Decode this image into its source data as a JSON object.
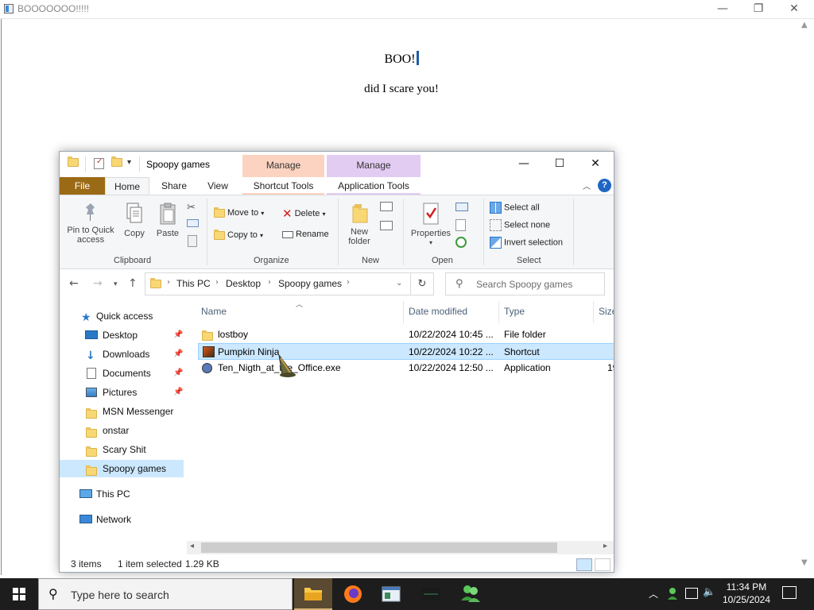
{
  "background_window": {
    "title": "BOOOOOOO!!!!!",
    "heading": "BOO!",
    "message": "did I scare you!"
  },
  "explorer": {
    "title": "Spoopy games",
    "context_tabs": {
      "shortcut": "Manage",
      "application": "Manage"
    },
    "tabs": {
      "file": "File",
      "home": "Home",
      "share": "Share",
      "view": "View",
      "shortcut_tools": "Shortcut Tools",
      "application_tools": "Application Tools"
    },
    "ribbon": {
      "clipboard": {
        "pin": "Pin to Quick access",
        "copy": "Copy",
        "paste": "Paste",
        "label": "Clipboard"
      },
      "organize": {
        "move_to": "Move to",
        "copy_to": "Copy to",
        "delete": "Delete",
        "rename": "Rename",
        "label": "Organize"
      },
      "new": {
        "new_folder": "New folder",
        "label": "New"
      },
      "open": {
        "properties": "Properties",
        "label": "Open"
      },
      "select": {
        "select_all": "Select all",
        "select_none": "Select none",
        "invert": "Invert selection",
        "label": "Select"
      }
    },
    "address": {
      "crumbs": [
        "This PC",
        "Desktop",
        "Spoopy games"
      ]
    },
    "search_placeholder": "Search Spoopy games",
    "nav": {
      "quick_access": "Quick access",
      "items": [
        "Desktop",
        "Downloads",
        "Documents",
        "Pictures",
        "MSN Messenger",
        "onstar",
        "Scary Shit",
        "Spoopy games"
      ],
      "this_pc": "This PC",
      "network": "Network"
    },
    "columns": {
      "name": "Name",
      "date": "Date modified",
      "type": "Type",
      "size": "Size"
    },
    "files": [
      {
        "name": "lostboy",
        "date": "10/22/2024 10:45 ...",
        "type": "File folder",
        "size": ""
      },
      {
        "name": "Pumpkin Ninja",
        "date": "10/22/2024 10:22 ...",
        "type": "Shortcut",
        "size": ""
      },
      {
        "name": "Ten_Nigth_at_the_Office.exe",
        "date": "10/22/2024 12:50 ...",
        "type": "Application",
        "size": "19"
      }
    ],
    "status": {
      "count": "3 items",
      "selected": "1 item selected",
      "size": "1.29 KB"
    }
  },
  "taskbar": {
    "search_placeholder": "Type here to search",
    "time": "11:34 PM",
    "date": "10/25/2024"
  },
  "colors": {
    "file_tab": "#9b6a16",
    "selection": "#cce8ff",
    "shortcut_tools": "#fbd3c0",
    "application_tools": "#e3ccf2"
  }
}
